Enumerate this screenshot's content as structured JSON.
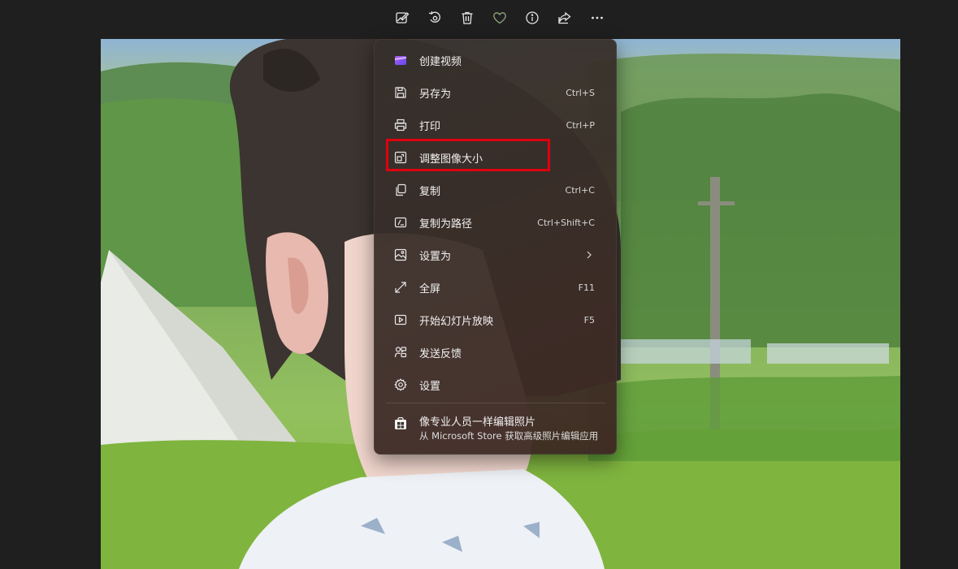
{
  "toolbar": {
    "buttons": [
      {
        "name": "edit-image-icon"
      },
      {
        "name": "rotate-icon"
      },
      {
        "name": "delete-icon"
      },
      {
        "name": "favorite-heart-icon"
      },
      {
        "name": "info-icon"
      },
      {
        "name": "share-icon"
      },
      {
        "name": "more-options-icon"
      }
    ]
  },
  "menu": {
    "items": [
      {
        "icon": "create-video-icon",
        "label": "创建视频",
        "shortcut": ""
      },
      {
        "icon": "save-icon",
        "label": "另存为",
        "shortcut": "Ctrl+S"
      },
      {
        "icon": "print-icon",
        "label": "打印",
        "shortcut": "Ctrl+P"
      },
      {
        "icon": "resize-image-icon",
        "label": "调整图像大小",
        "shortcut": ""
      },
      {
        "icon": "copy-icon",
        "label": "复制",
        "shortcut": "Ctrl+C"
      },
      {
        "icon": "copy-path-icon",
        "label": "复制为路径",
        "shortcut": "Ctrl+Shift+C"
      },
      {
        "icon": "set-as-icon",
        "label": "设置为",
        "shortcut": ""
      },
      {
        "icon": "fullscreen-icon",
        "label": "全屏",
        "shortcut": "F11"
      },
      {
        "icon": "slideshow-icon",
        "label": "开始幻灯片放映",
        "shortcut": "F5"
      },
      {
        "icon": "feedback-icon",
        "label": "发送反馈",
        "shortcut": ""
      },
      {
        "icon": "settings-icon",
        "label": "设置",
        "shortcut": ""
      }
    ],
    "promo": {
      "icon": "store-icon",
      "title": "像专业人员一样编辑照片",
      "subtitle": "从 Microsoft Store 获取高级照片编辑应用"
    }
  },
  "colors": {
    "highlight_border": "#e0000f",
    "menu_background": "#3a302b",
    "app_background": "#1f1f1f"
  }
}
